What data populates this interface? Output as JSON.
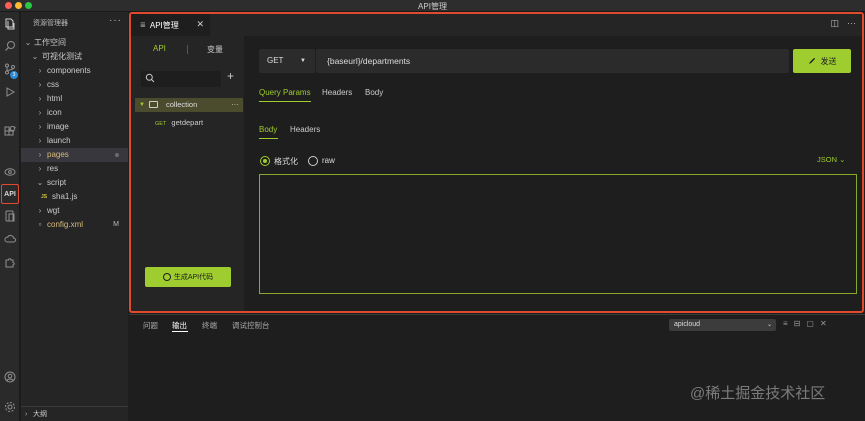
{
  "window": {
    "title": "API管理"
  },
  "activity_bar": {
    "icons": [
      "files-icon",
      "search-icon",
      "source-control-icon",
      "run-debug-icon",
      "extensions-icon",
      "preview-icon",
      "api-icon",
      "devices-icon",
      "cloud-icon",
      "plugins-icon",
      "account-icon",
      "settings-icon"
    ],
    "badge_count": "3",
    "api_label": "API"
  },
  "explorer": {
    "header": "资源管理器",
    "more": "···",
    "workspace_label": "工作空间",
    "project_label": "可视化测试",
    "items": [
      {
        "label": "components",
        "kind": "folder"
      },
      {
        "label": "css",
        "kind": "folder"
      },
      {
        "label": "html",
        "kind": "folder"
      },
      {
        "label": "icon",
        "kind": "folder"
      },
      {
        "label": "image",
        "kind": "folder"
      },
      {
        "label": "launch",
        "kind": "folder"
      },
      {
        "label": "pages",
        "kind": "folder"
      },
      {
        "label": "res",
        "kind": "folder"
      },
      {
        "label": "script",
        "kind": "folder-open"
      },
      {
        "label": "sha1.js",
        "kind": "file-js"
      },
      {
        "label": "wgt",
        "kind": "folder"
      },
      {
        "label": "config.xml",
        "kind": "file"
      }
    ],
    "config_badge": "M",
    "js_icon_text": "JS",
    "outline_label": "大纲"
  },
  "editor_tab": {
    "label": "API管理",
    "close": "✕"
  },
  "api_left": {
    "segment_api": "API",
    "segment_vars": "变量",
    "add_symbol": "+",
    "collection_label": "collection",
    "collection_more": "···",
    "request": {
      "method": "GET",
      "name": "getdepart"
    },
    "generate_button": "生成API代码"
  },
  "request_bar": {
    "method": "GET",
    "url": "{baseurl}/departments",
    "send_button": "发送"
  },
  "request_tabs": [
    "Query Params",
    "Headers",
    "Body"
  ],
  "response_tabs": [
    "Body",
    "Headers"
  ],
  "format_options": {
    "formatted": "格式化",
    "raw": "raw",
    "type": "JSON"
  },
  "bottom_panel": {
    "tabs": [
      "问题",
      "输出",
      "终端",
      "调试控制台"
    ],
    "active_tab": "输出",
    "output_select": "apicloud"
  },
  "watermark": "@稀土掘金技术社区",
  "colors": {
    "accent": "#9fcc2e",
    "highlight_border": "#e04a2d",
    "background": "#1e1e1e",
    "sidebar": "#252526"
  }
}
